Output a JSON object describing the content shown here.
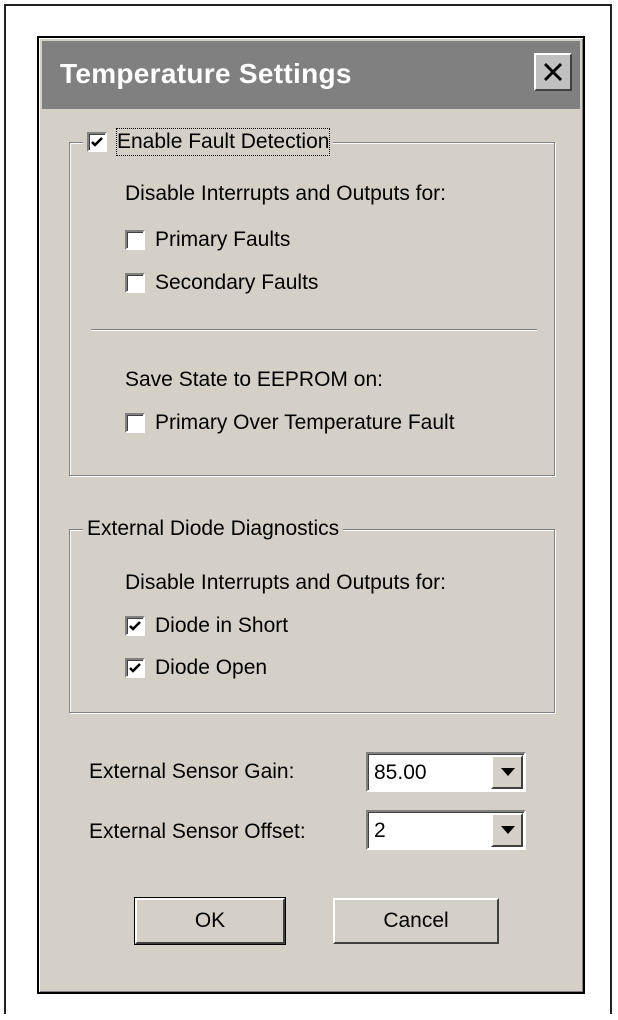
{
  "dialog": {
    "title": "Temperature Settings",
    "close_icon": "close-icon"
  },
  "fault_group": {
    "enable_label": "Enable Fault Detection",
    "enable_checked": true,
    "disable_heading": "Disable Interrupts and Outputs for:",
    "primary_faults": {
      "label": "Primary Faults",
      "checked": false
    },
    "secondary_faults": {
      "label": "Secondary Faults",
      "checked": false
    },
    "save_heading": "Save State to EEPROM on:",
    "primary_over_temp": {
      "label": "Primary Over Temperature Fault",
      "checked": false
    }
  },
  "diode_group": {
    "legend": "External Diode Diagnostics",
    "disable_heading": "Disable Interrupts and Outputs for:",
    "diode_short": {
      "label": "Diode in Short",
      "checked": true
    },
    "diode_open": {
      "label": "Diode Open",
      "checked": true
    }
  },
  "sensor": {
    "gain_label": "External Sensor Gain:",
    "gain_value": "85.00",
    "offset_label": "External Sensor Offset:",
    "offset_value": "2"
  },
  "buttons": {
    "ok": "OK",
    "cancel": "Cancel"
  },
  "colors": {
    "dialog_bg": "#d4d0c8",
    "titlebar_bg": "#808080",
    "title_text": "#ffffff"
  }
}
